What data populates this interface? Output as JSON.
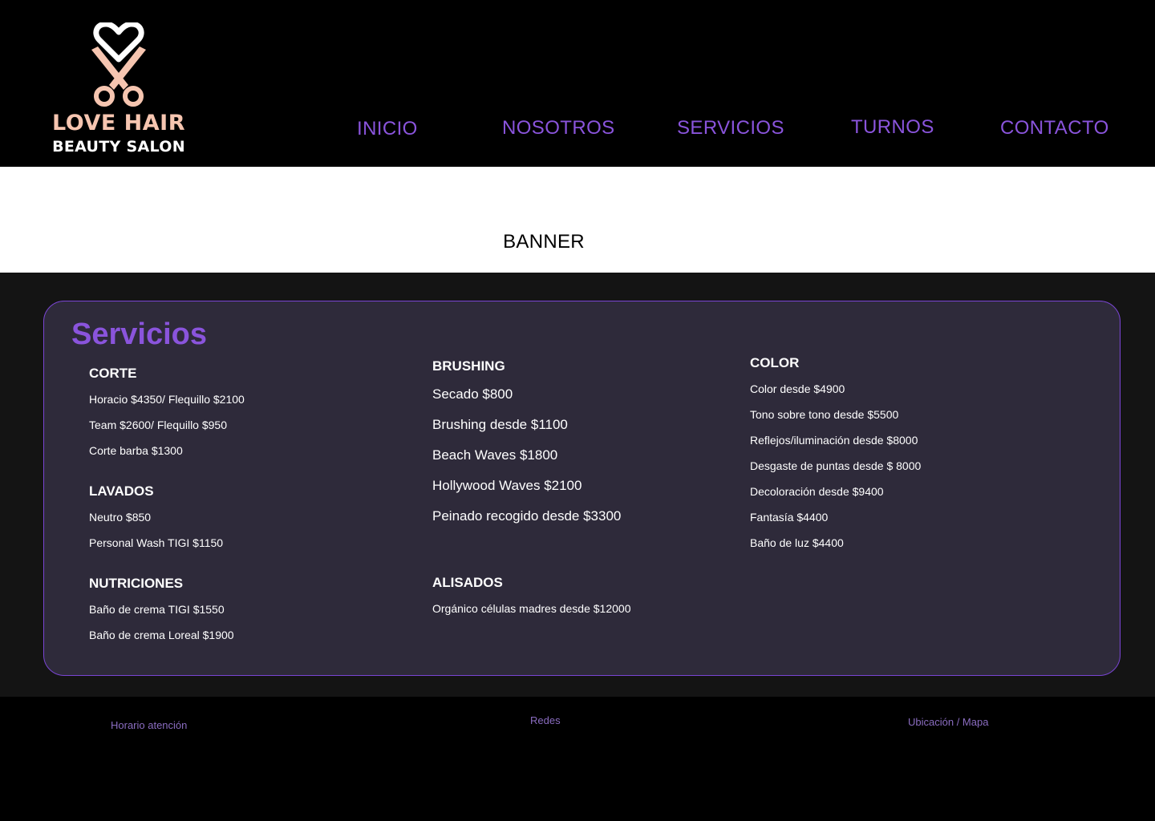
{
  "brand": {
    "logo_icon": "heart-scissors-icon",
    "name_line1": "LOVE HAIR",
    "name_line2": "BEAUTY SALON"
  },
  "nav": {
    "items": [
      "INICIO",
      "NOSOTROS",
      "SERVICIOS",
      "TURNOS",
      "CONTACTO"
    ]
  },
  "banner": {
    "label": "BANNER"
  },
  "services": {
    "title": "Servicios",
    "corte": {
      "title": "CORTE",
      "items": [
        "Horacio $4350/ Flequillo $2100",
        "Team $2600/ Flequillo $950",
        "Corte barba $1300"
      ]
    },
    "lavados": {
      "title": "LAVADOS",
      "items": [
        "Neutro $850",
        "Personal Wash TIGI $1150"
      ]
    },
    "nutriciones": {
      "title": "NUTRICIONES",
      "items": [
        "Baño de crema TIGI $1550",
        "Baño de crema Loreal $1900"
      ]
    },
    "brushing": {
      "title": "BRUSHING",
      "items": [
        "Secado $800",
        "Brushing desde $1100",
        "Beach Waves $1800",
        "Hollywood Waves $2100",
        "Peinado recogido desde $3300"
      ]
    },
    "alisados": {
      "title": "ALISADOS",
      "items": [
        "Orgánico células madres desde $12000"
      ]
    },
    "color": {
      "title": "COLOR",
      "items": [
        "Color desde $4900",
        "Tono sobre tono desde $5500",
        "Reflejos/iluminación desde $8000",
        "Desgaste de puntas desde $ 8000",
        "Decoloración desde $9400",
        "Fantasía  $4400",
        "Baño de luz $4400"
      ]
    }
  },
  "footer": {
    "hours": "Horario atención",
    "social": "Redes",
    "location": "Ubicación / Mapa"
  },
  "colors": {
    "accent": "#8a54dc",
    "logo_peach": "#f6c5b0",
    "card_bg": "#2e2a3a",
    "section_bg": "#141414",
    "header_bg": "#000000"
  }
}
